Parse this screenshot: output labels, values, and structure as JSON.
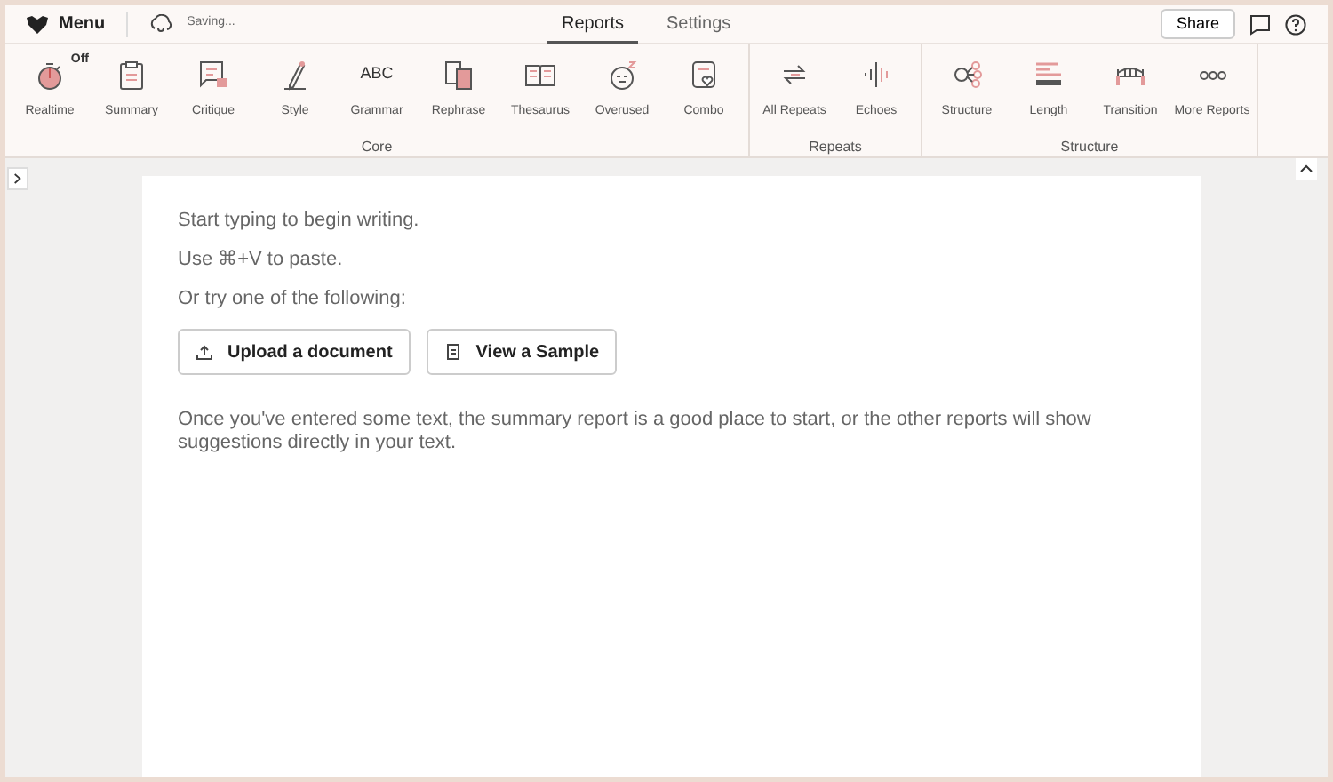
{
  "top_bar": {
    "menu": "Menu",
    "save_status": "Saving...",
    "tabs": [
      {
        "label": "Reports",
        "selected": true
      },
      {
        "label": "Settings",
        "selected": false
      }
    ],
    "share": "Share"
  },
  "toolbar": [
    {
      "group": "Core",
      "items": [
        {
          "label": "Realtime",
          "badge": "Off"
        },
        {
          "label": "Summary"
        },
        {
          "label": "Critique"
        },
        {
          "label": "Style"
        },
        {
          "label": "Grammar",
          "glyph": "ABC"
        },
        {
          "label": "Rephrase"
        },
        {
          "label": "Thesaurus"
        },
        {
          "label": "Overused"
        },
        {
          "label": "Combo"
        }
      ]
    },
    {
      "group": "Repeats",
      "items": [
        {
          "label": "All Repeats"
        },
        {
          "label": "Echoes"
        }
      ]
    },
    {
      "group": "Structure",
      "items": [
        {
          "label": "Structure"
        },
        {
          "label": "Length"
        },
        {
          "label": "Transition"
        },
        {
          "label": "More Reports"
        }
      ]
    }
  ],
  "document": {
    "lines": [
      "Start typing to begin writing.",
      "Use ⌘+V to paste.",
      "Or try one of the following:"
    ],
    "buttons": [
      {
        "label": "Upload a document"
      },
      {
        "label": "View a Sample"
      }
    ],
    "hint": "Once you've entered some text, the summary report is a good place to start, or the other reports will show suggestions directly in your text."
  }
}
